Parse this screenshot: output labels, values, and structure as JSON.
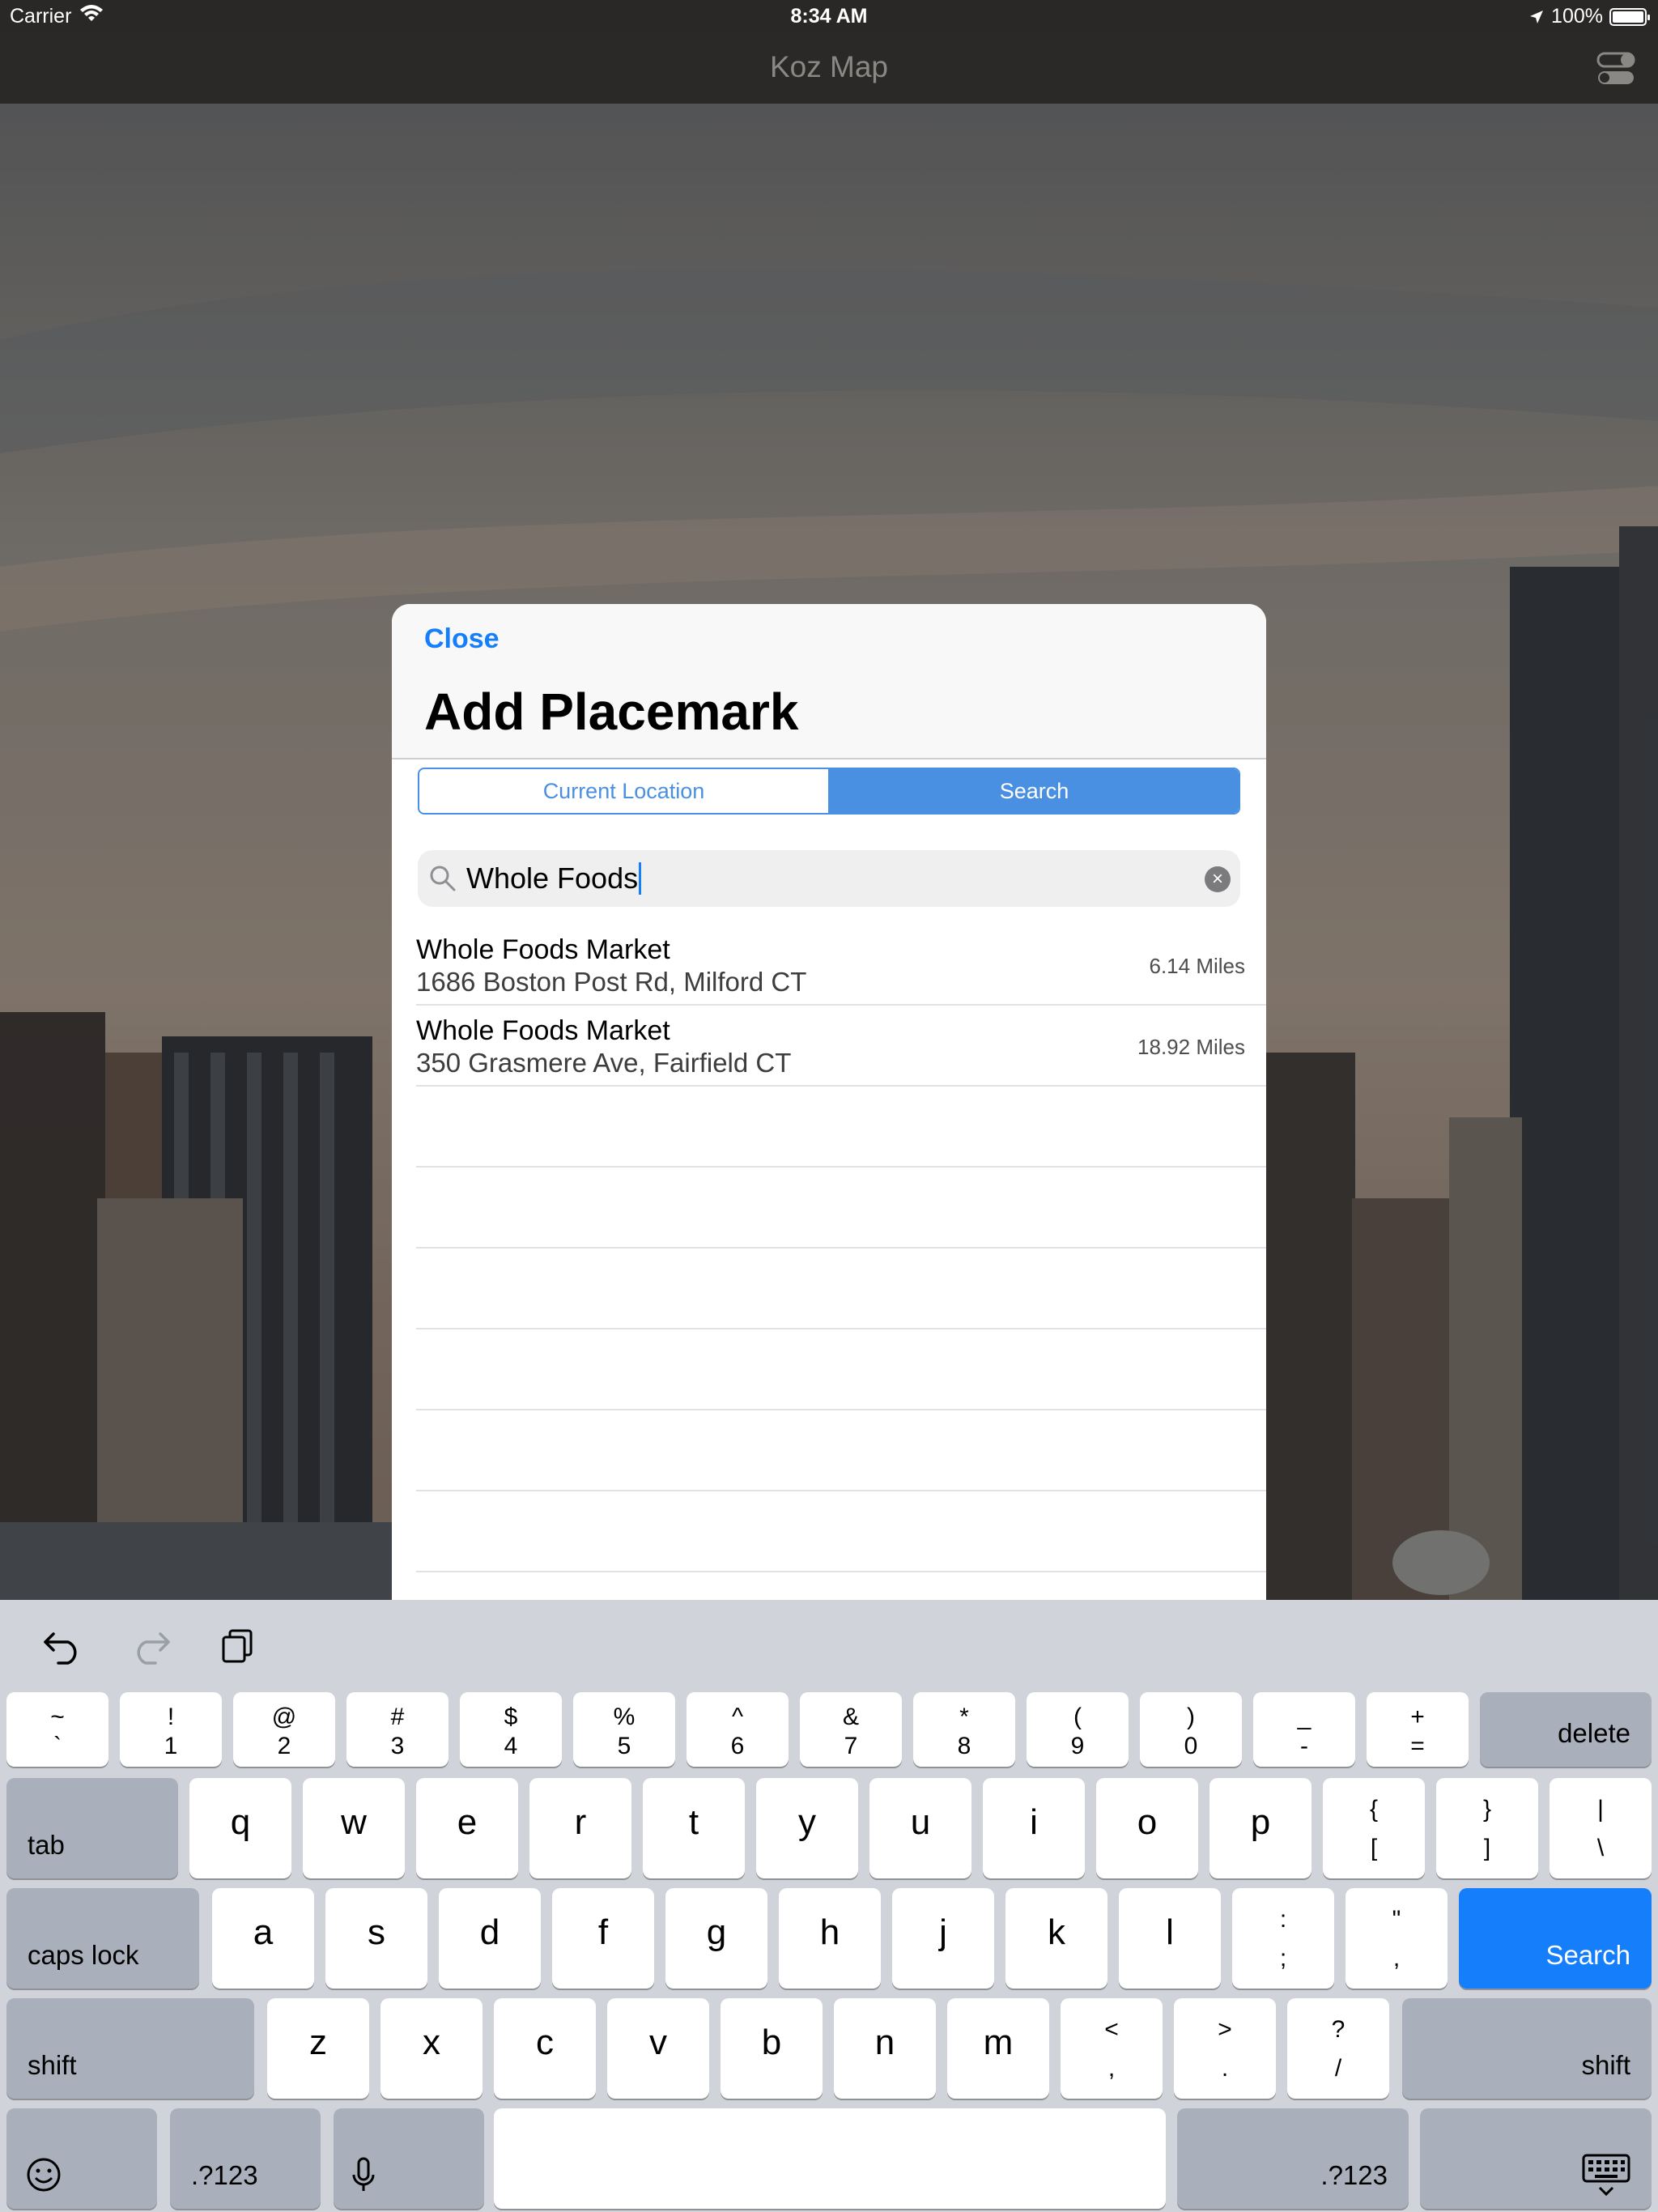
{
  "status_bar": {
    "carrier": "Carrier",
    "time": "8:34 AM",
    "battery": "100%"
  },
  "nav": {
    "title": "Koz Map"
  },
  "modal": {
    "close_label": "Close",
    "title": "Add Placemark",
    "segments": [
      "Current Location",
      "Search"
    ],
    "active_segment": 1,
    "search_value": "Whole Foods",
    "results": [
      {
        "name": "Whole Foods Market",
        "address": "1686 Boston Post Rd, Milford CT",
        "distance": "6.14 Miles"
      },
      {
        "name": "Whole Foods Market",
        "address": "350 Grasmere Ave, Fairfield CT",
        "distance": "18.92 Miles"
      }
    ]
  },
  "keyboard": {
    "number_row": [
      {
        "top": "~",
        "bottom": "`"
      },
      {
        "top": "!",
        "bottom": "1"
      },
      {
        "top": "@",
        "bottom": "2"
      },
      {
        "top": "#",
        "bottom": "3"
      },
      {
        "top": "$",
        "bottom": "4"
      },
      {
        "top": "%",
        "bottom": "5"
      },
      {
        "top": "^",
        "bottom": "6"
      },
      {
        "top": "&",
        "bottom": "7"
      },
      {
        "top": "*",
        "bottom": "8"
      },
      {
        "top": "(",
        "bottom": "9"
      },
      {
        "top": ")",
        "bottom": "0"
      },
      {
        "top": "_",
        "bottom": "-"
      },
      {
        "top": "+",
        "bottom": "="
      }
    ],
    "delete_label": "delete",
    "tab_label": "tab",
    "row_q": [
      "q",
      "w",
      "e",
      "r",
      "t",
      "y",
      "u",
      "i",
      "o",
      "p"
    ],
    "row_q_symbols": [
      {
        "top": "{",
        "bottom": "["
      },
      {
        "top": "}",
        "bottom": "]"
      },
      {
        "top": "|",
        "bottom": "\\"
      }
    ],
    "caps_label": "caps lock",
    "row_a": [
      "a",
      "s",
      "d",
      "f",
      "g",
      "h",
      "j",
      "k",
      "l"
    ],
    "row_a_symbols": [
      {
        "top": ":",
        "bottom": ";"
      },
      {
        "top": "\"",
        "bottom": ","
      }
    ],
    "search_label": "Search",
    "shift_label": "shift",
    "row_z": [
      "z",
      "x",
      "c",
      "v",
      "b",
      "n",
      "m"
    ],
    "row_z_symbols": [
      {
        "top": "<",
        "bottom": ","
      },
      {
        "top": ">",
        "bottom": "."
      },
      {
        "top": "?",
        "bottom": "/"
      }
    ],
    "numbers_label": ".?123"
  }
}
